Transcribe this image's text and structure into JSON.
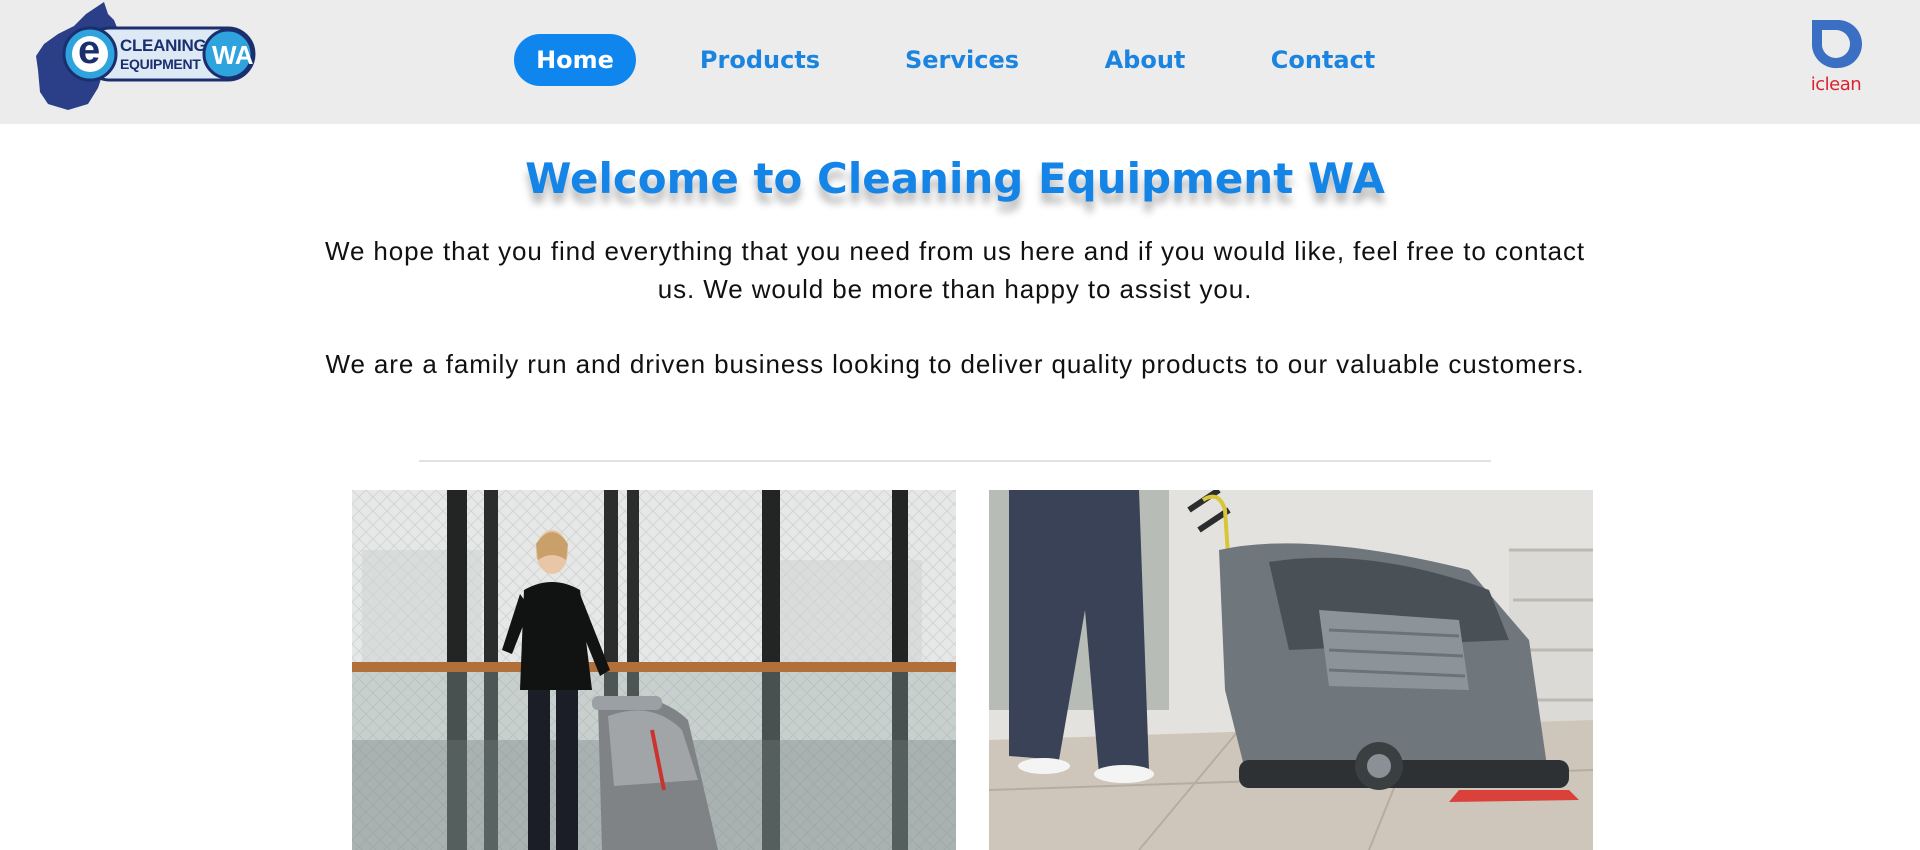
{
  "header": {
    "logo": {
      "line1": "CLEANING",
      "line2": "EQUIPMENT",
      "badge": "WA",
      "letter": "e",
      "icon": "western-australia-map-logo"
    },
    "nav": [
      {
        "label": "Home",
        "active": true
      },
      {
        "label": "Products",
        "active": false
      },
      {
        "label": "Services",
        "active": false
      },
      {
        "label": "About",
        "active": false
      },
      {
        "label": "Contact",
        "active": false
      }
    ],
    "partner_logo": {
      "label": "iclean",
      "icon": "iclean-logo"
    }
  },
  "main": {
    "title": "Welcome to Cleaning Equipment WA",
    "paragraph1": "We hope that you find everything that you need from us here and if you would like, feel free to contact us. We would be more than happy to assist you.",
    "paragraph2": "We are a family run and driven business looking to deliver quality products to our valuable customers."
  },
  "colors": {
    "accent": "#0f86ee",
    "header_bg": "#ececec",
    "logo_navy": "#1b2f6e",
    "brand_red": "#d9232e"
  }
}
